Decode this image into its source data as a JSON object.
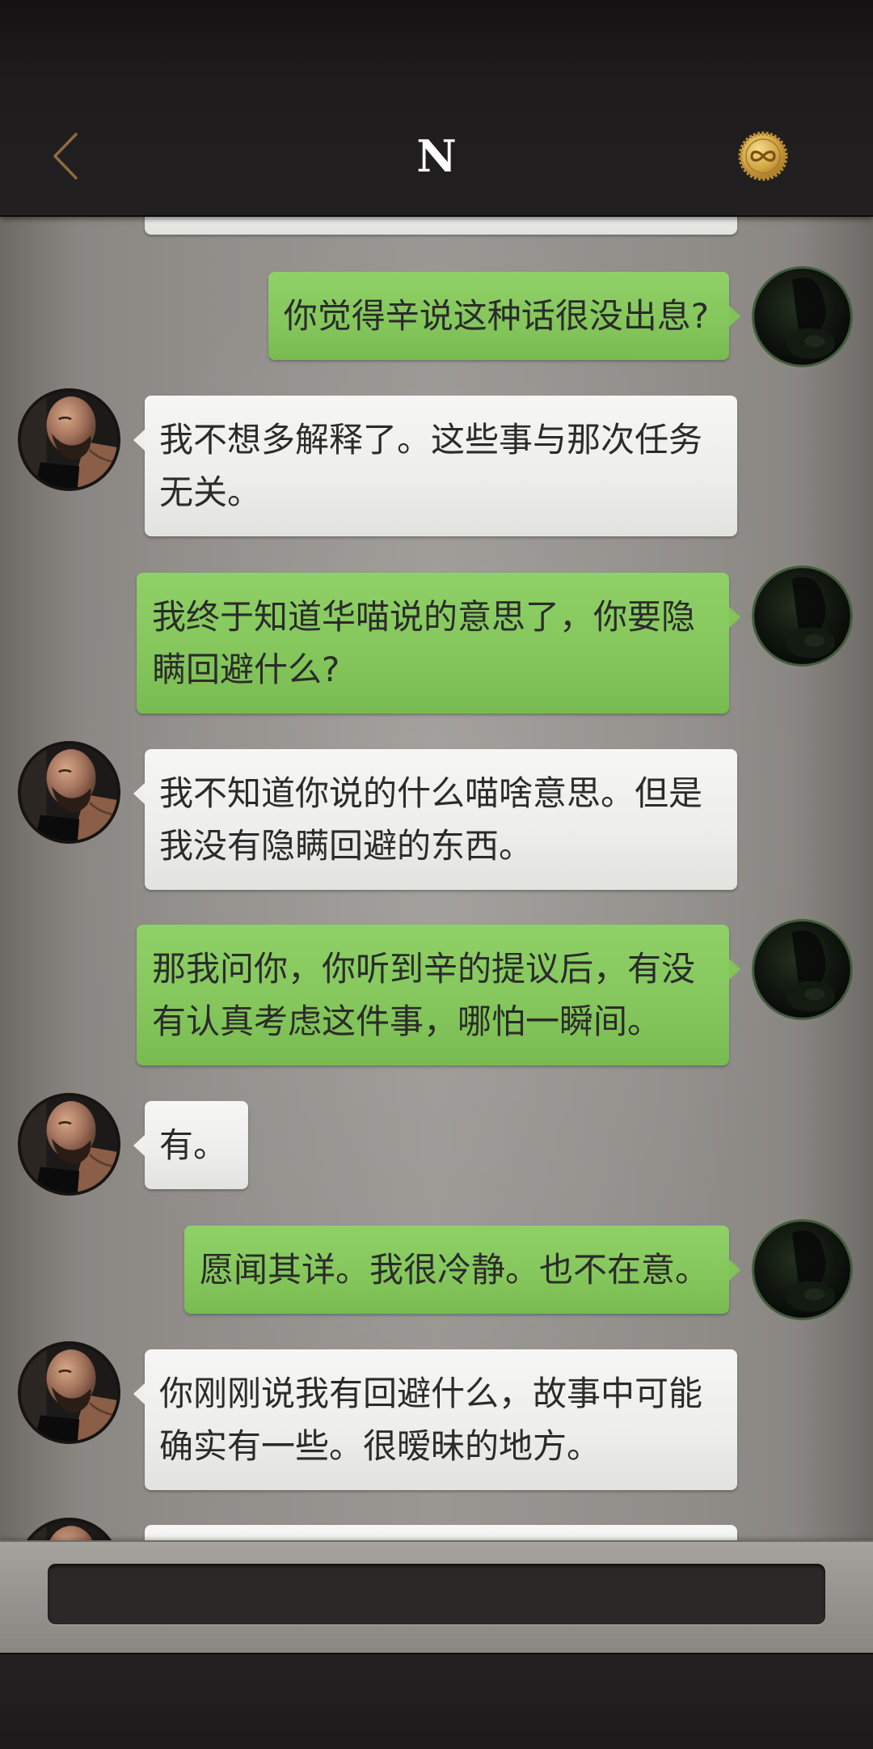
{
  "header": {
    "title": "N",
    "back_icon": "chevron-left-icon",
    "badge_icon": "infinity-badge-icon"
  },
  "theme": {
    "header_bg": "#221f20",
    "chat_bg": "#908d89",
    "green_bubble": "#84c65b",
    "white_bubble": "#eeeeec",
    "accent_gold": "#c89b45",
    "input_bg": "#2a2928"
  },
  "messages": [
    {
      "avatar": "user-avatar",
      "text": "你觉得辛说这种话很没出息?"
    },
    {
      "avatar": "contact-avatar",
      "text": "我不想多解释了。这些事与那次任务无关。"
    },
    {
      "avatar": "user-avatar",
      "text": "我终于知道华喵说的意思了，你要隐瞒回避什么?"
    },
    {
      "avatar": "contact-avatar",
      "text": "我不知道你说的什么喵啥意思。但是我没有隐瞒回避的东西。"
    },
    {
      "avatar": "user-avatar",
      "text": "那我问你，你听到辛的提议后，有没有认真考虑这件事，哪怕一瞬间。"
    },
    {
      "avatar": "contact-avatar",
      "text": "有。"
    },
    {
      "avatar": "user-avatar",
      "text": "愿闻其详。我很冷静。也不在意。"
    },
    {
      "avatar": "contact-avatar",
      "text": "你刚刚说我有回避什么，故事中可能确实有一些。很暧昧的地方。"
    }
  ]
}
